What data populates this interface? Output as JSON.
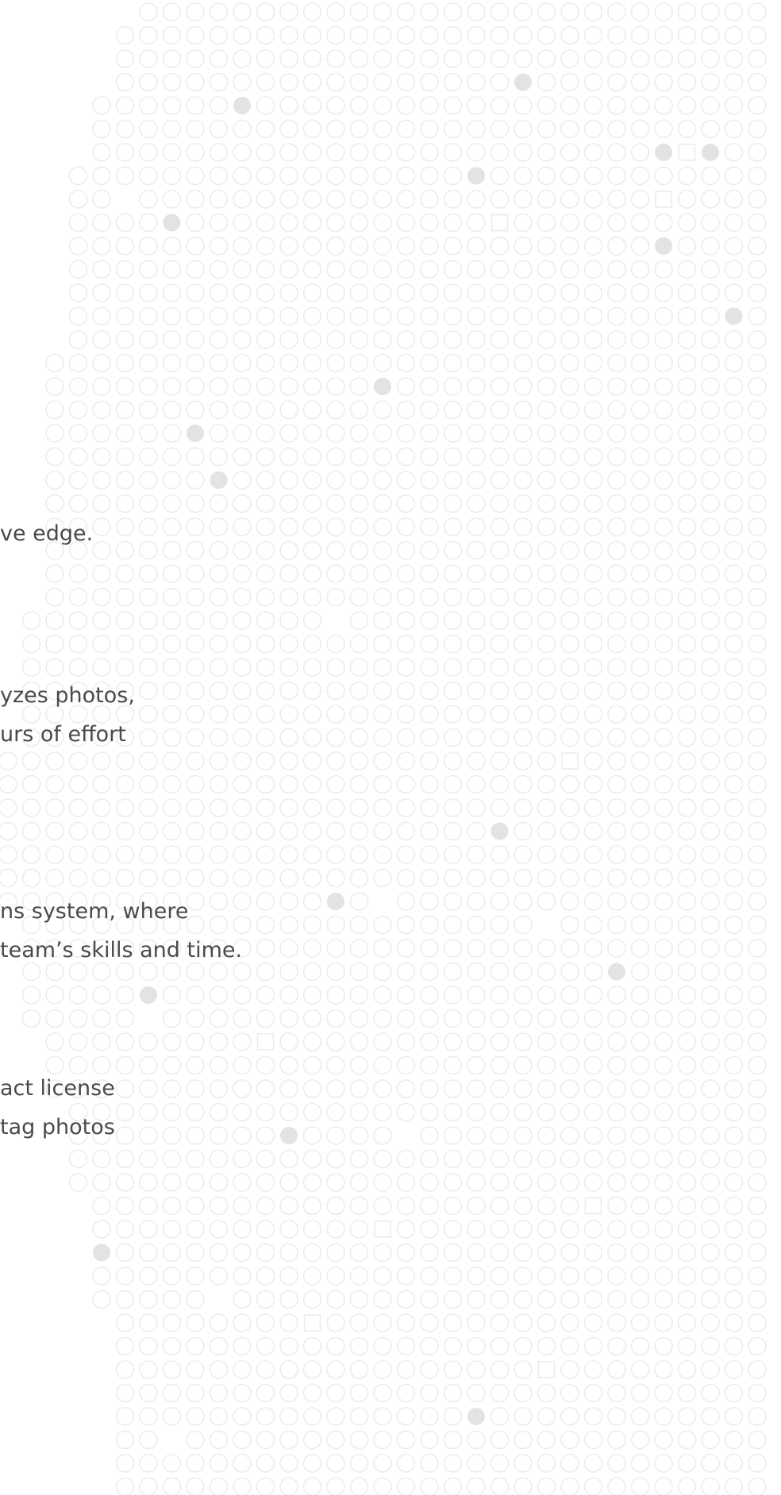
{
  "pattern": {
    "ring_color": "#ececec",
    "fill_color": "#e3e3e3",
    "shapes": [
      "ring",
      "filled-dot",
      "square-outline"
    ]
  },
  "text_fragments": [
    "ve edge.",
    "yzes photos,",
    "urs of effort",
    "ns system, where",
    "team’s skills and time.",
    "act license",
    "tag photos"
  ]
}
